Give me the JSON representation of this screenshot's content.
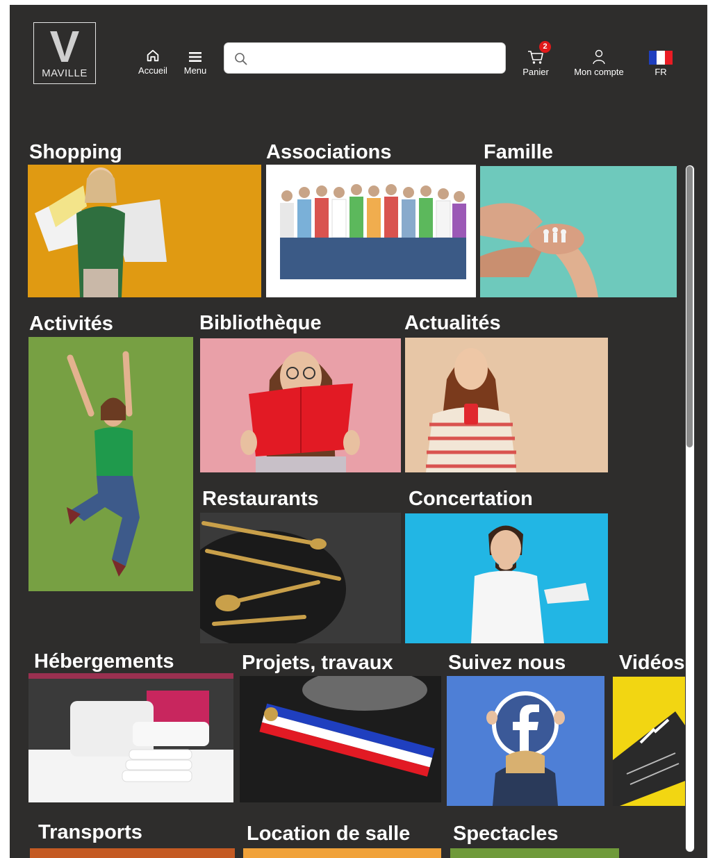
{
  "header": {
    "logo_letter": "V",
    "logo_text": "MAVILLE",
    "home_label": "Accueil",
    "menu_label": "Menu",
    "search_placeholder": "",
    "cart_label": "Panier",
    "cart_count": "2",
    "account_label": "Mon compte",
    "lang_label": "FR"
  },
  "tiles": {
    "shopping": "Shopping",
    "associations": "Associations",
    "famille": "Famille",
    "activites": "Activités",
    "bibliotheque": "Bibliothèque",
    "actualites": "Actualités",
    "restaurants": "Restaurants",
    "concertation": "Concertation",
    "hebergements": "Hébergements",
    "projets": "Projets, travaux",
    "suivez": "Suivez nous",
    "videos": "Vidéos",
    "transports": "Transports",
    "location": "Location de salle",
    "spectacles": "Spectacles"
  },
  "colors": {
    "background": "#2e2d2c",
    "shopping": "#e09a12",
    "famille": "#6ec9bc",
    "activites": "#77a043",
    "bibliotheque": "#e9a0a8",
    "actualites": "#e7c6a6",
    "concertation": "#22b6e4",
    "suivez": "#4e7fd6",
    "videos": "#f2d612",
    "transports": "#c45a23",
    "location": "#f0a23a",
    "spectacles": "#6f9a3a"
  }
}
